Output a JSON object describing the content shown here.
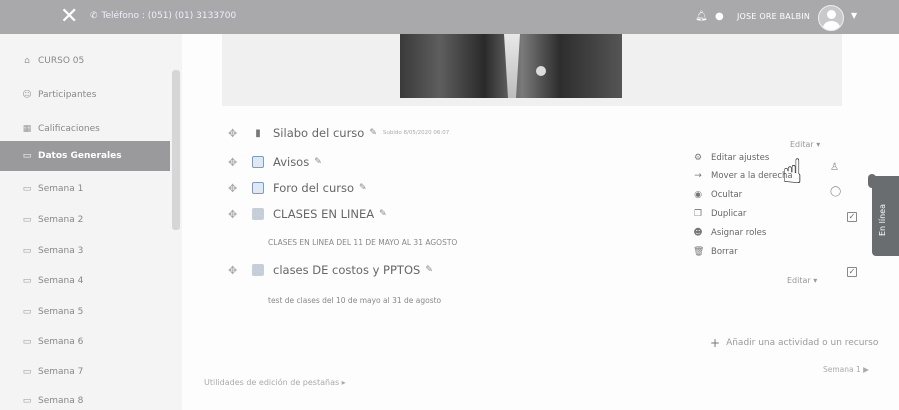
{
  "topbar": {
    "phone": "Teléfono : (051) (01) 3133700",
    "username": "JOSE ORE BALBIN"
  },
  "sidebar": {
    "items": [
      {
        "label": "CURSO 05",
        "icon": "graduation-cap-icon"
      },
      {
        "label": "Participantes",
        "icon": "users-icon"
      },
      {
        "label": "Calificaciones",
        "icon": "table-icon"
      },
      {
        "label": "Datos Generales",
        "icon": "folder-icon",
        "active": true
      },
      {
        "label": "Semana 1",
        "icon": "folder-icon"
      },
      {
        "label": "Semana 2",
        "icon": "folder-icon"
      },
      {
        "label": "Semana 3",
        "icon": "folder-icon"
      },
      {
        "label": "Semana 4",
        "icon": "folder-icon"
      },
      {
        "label": "Semana 5",
        "icon": "folder-icon"
      },
      {
        "label": "Semana 6",
        "icon": "folder-icon"
      },
      {
        "label": "Semana 7",
        "icon": "folder-icon"
      },
      {
        "label": "Semana 8",
        "icon": "folder-icon"
      }
    ]
  },
  "activities": {
    "silabo": {
      "name": "Silabo del curso",
      "uploaded": "Subido 8/05/2020 06:07"
    },
    "avisos": {
      "name": "Avisos"
    },
    "foro": {
      "name": "Foro del curso"
    },
    "clases_linea": {
      "name": "CLASES EN LINEA",
      "desc": "CLASES EN LINEA DEL 11 DE MAYO AL 31 AGOSTO"
    },
    "clases_costos": {
      "name": "clases DE costos y PPTOS",
      "desc": "test de clases del 10 de mayo al 31 de agosto"
    }
  },
  "edit_menu": {
    "editar_label": "Editar",
    "items": [
      {
        "label": "Editar ajustes",
        "icon": "gear-icon"
      },
      {
        "label": "Mover a la derecha",
        "icon": "arrow-right-icon"
      },
      {
        "label": "Ocultar",
        "icon": "eye-icon"
      },
      {
        "label": "Duplicar",
        "icon": "copy-icon"
      },
      {
        "label": "Asignar roles",
        "icon": "user-icon"
      },
      {
        "label": "Borrar",
        "icon": "trash-icon"
      }
    ]
  },
  "online_tab": "En línea",
  "footer": {
    "add_activity": "Añadir una actividad o un recurso",
    "utilities": "Utilidades de edición de pestañas",
    "next_week": "Semana 1"
  },
  "colors": {
    "topbar": "#a9a9ab",
    "active_nav": "#9a9a9c",
    "online_tab": "#6a6d70"
  }
}
